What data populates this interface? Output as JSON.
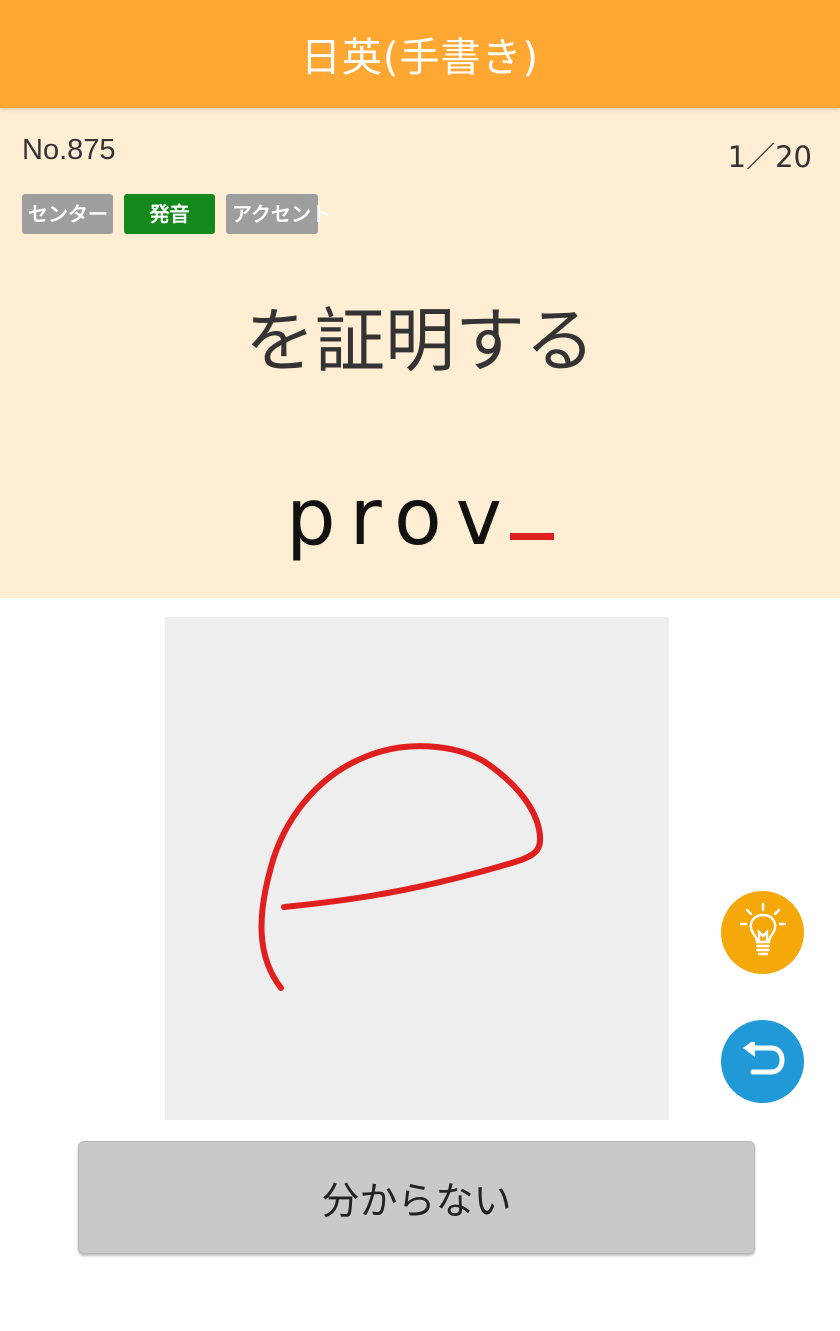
{
  "header": {
    "title": "日英(手書き)"
  },
  "question": {
    "number": "No.875",
    "progress": "1／20",
    "tags": [
      {
        "label": "センター",
        "active": false
      },
      {
        "label": "発音",
        "active": true
      },
      {
        "label": "アクセント",
        "active": false
      }
    ],
    "japanese": "を証明する",
    "answer_typed": "prov"
  },
  "colors": {
    "header": "#ffa733",
    "card": "#ffeed3",
    "tag_inactive": "#9e9e9e",
    "tag_active": "#13891c",
    "stroke": "#e0201e",
    "hint": "#f5a80a",
    "undo": "#1f9ad6"
  },
  "handwriting": {
    "recognized_letter": "e"
  },
  "icons": {
    "hint": "lightbulb-icon",
    "undo": "undo-icon"
  },
  "buttons": {
    "dont_know": "分からない"
  }
}
